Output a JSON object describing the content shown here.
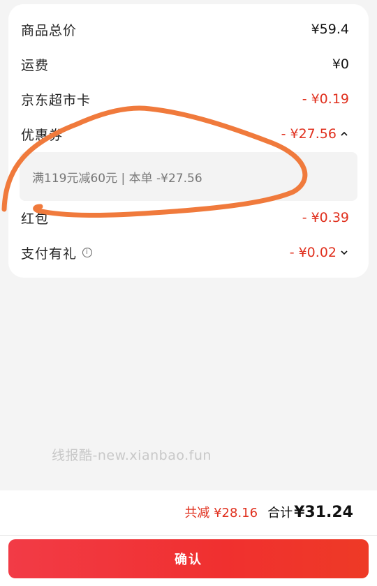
{
  "breakdown": [
    {
      "label": "商品总价",
      "value": "¥59.4",
      "highlight": false
    },
    {
      "label": "运费",
      "value": "¥0",
      "highlight": false
    },
    {
      "label": "京东超市卡",
      "value": "- ¥0.19",
      "highlight": true
    },
    {
      "label": "优惠券",
      "value": "- ¥27.56",
      "highlight": true
    },
    {
      "label": "红包",
      "value": "- ¥0.39",
      "highlight": true
    },
    {
      "label": "支付有礼",
      "value": "- ¥0.02",
      "highlight": true
    }
  ],
  "coupon_detail": "满119元减60元 | 本单 -¥27.56",
  "watermark": "线报酷-new.xianbao.fun",
  "footer": {
    "saved_text": "共减 ¥28.16",
    "total_label": "合计",
    "total_value": "¥31.24",
    "confirm_label": "确认"
  },
  "colors": {
    "accent_red": "#e0301e",
    "annotation_orange": "#f07a3c",
    "button_red": "#f0302f"
  }
}
